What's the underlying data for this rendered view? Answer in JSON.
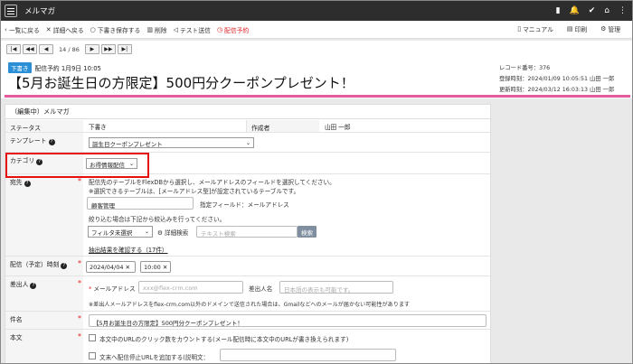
{
  "topbar": {
    "title": "メルマガ"
  },
  "actions": {
    "back_list": "一覧に戻る",
    "back_detail": "詳細へ戻る",
    "save_draft": "下書き保存する",
    "delete": "削除",
    "test_send": "テスト送信",
    "schedule": "配信予約",
    "manual": "マニュアル",
    "print": "印刷",
    "admin": "管理"
  },
  "pager": {
    "info": "14 / 86"
  },
  "header": {
    "badge": "下書き",
    "scheduled": "配信予約  1月9日 10:05",
    "title": "【5月お誕生日の方限定】500円分クーポンプレゼント！",
    "record_no": "レコード番号：376",
    "created": "登録時刻：2024/01/09 10:05:51 山田 一郎",
    "updated": "更新時刻：2024/03/12 16:03:13 山田 一郎"
  },
  "form": {
    "heading": "（編集中）メルマガ",
    "status_label": "ステータス",
    "status_value": "下書き",
    "author_label": "作成者",
    "author_value": "山田 一郎",
    "template_label": "テンプレート",
    "template_value": "誕生日クーポンプレゼント",
    "category_label": "カテゴリ",
    "category_value": "お得情報配信",
    "dest_label": "宛先",
    "dest_note1": "配信先のテーブルをFlexDBから選択し、メールアドレスのフィールドを選択してください。",
    "dest_note2": "※選択できるテーブルは、[メールアドレス型]が設定されているテーブルです。",
    "dest_table": "顧客管理",
    "dest_field": "指定フィールド：メールアドレス",
    "dest_filter_note": "絞り込む場合は下記から絞込みを行ってください。",
    "filter_select": "フィルタ未選択",
    "detail_search": "詳細検索",
    "text_search_ph": "テキスト検索",
    "search_btn": "検索",
    "extract_link": "抽出結果を確認する（17件）",
    "send_time_label": "配信（予定）時刻",
    "send_date": "2024/04/04",
    "send_time": "10:00",
    "sender_label": "差出人",
    "sender_email_label": "メールアドレス",
    "sender_email_ph": "xxx@flex-crm.com",
    "sender_name_label": "差出人名",
    "sender_name_ph": "日本語の表示も可能です。",
    "sender_note": "※差出人メールアドレスをflex-crm.com以外のドメインで送信された場合は、Gmailなどへのメールが届かない可能性があります",
    "subject_label": "件名",
    "subject_value": "【5月お誕生日の方限定】500円分クーポンプレゼント！",
    "body_label": "本文",
    "body_opt1": "本文中のURLのクリック数をカウントする(メール配信時に本文中のURLが書き換えられます)",
    "body_opt2": "文末へ配信停止URLを追加する(説明文："
  },
  "colors": {
    "accent_pink": "#e75aa0",
    "badge_blue": "#2a8fd6",
    "highlight_red": "#e51010",
    "required_red": "#e02020"
  }
}
